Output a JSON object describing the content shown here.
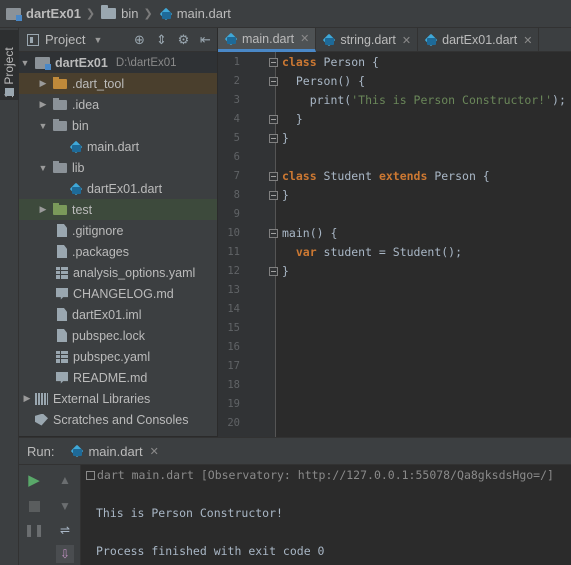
{
  "breadcrumb": {
    "items": [
      {
        "label": "dartEx01",
        "icon": "module-icon"
      },
      {
        "label": "bin",
        "icon": "folder-icon"
      },
      {
        "label": "main.dart",
        "icon": "dart-file-icon"
      }
    ]
  },
  "left_strip": {
    "project_tab": "1: Project"
  },
  "project_panel": {
    "title": "Project",
    "tools": [
      "target-icon",
      "collapse-icon",
      "gear-icon",
      "hide-icon"
    ]
  },
  "tree": {
    "root": {
      "label": "dartEx01",
      "path": "D:\\dartEx01"
    },
    "items": [
      {
        "label": ".dart_tool"
      },
      {
        "label": ".idea"
      },
      {
        "label": "bin"
      },
      {
        "label": "main.dart"
      },
      {
        "label": "lib"
      },
      {
        "label": "dartEx01.dart"
      },
      {
        "label": "test"
      },
      {
        "label": ".gitignore"
      },
      {
        "label": ".packages"
      },
      {
        "label": "analysis_options.yaml"
      },
      {
        "label": "CHANGELOG.md"
      },
      {
        "label": "dartEx01.iml"
      },
      {
        "label": "pubspec.lock"
      },
      {
        "label": "pubspec.yaml"
      },
      {
        "label": "README.md"
      },
      {
        "label": "External Libraries"
      },
      {
        "label": "Scratches and Consoles"
      }
    ]
  },
  "editor": {
    "tabs": [
      {
        "label": "main.dart",
        "active": true
      },
      {
        "label": "string.dart",
        "active": false
      },
      {
        "label": "dartEx01.dart",
        "active": false
      }
    ],
    "line_numbers": [
      "1",
      "2",
      "3",
      "4",
      "5",
      "6",
      "7",
      "8",
      "9",
      "10",
      "11",
      "12",
      "13",
      "14",
      "15",
      "16",
      "17",
      "18",
      "19",
      "20"
    ],
    "code": {
      "l1_kw": "class",
      "l1_rest": " Person {",
      "l2": "  Person() {",
      "l3_a": "    print(",
      "l3_str": "'This is Person Constructor!'",
      "l3_b": ");",
      "l4": "  }",
      "l5": "}",
      "l7_kw1": "class",
      "l7_mid": " Student ",
      "l7_kw2": "extends",
      "l7_rest": " Person {",
      "l8": "}",
      "l10": "main() {",
      "l11_kw": "  var",
      "l11_rest": " student = Student();",
      "l12": "}"
    }
  },
  "run": {
    "label": "Run:",
    "tab": "main.dart",
    "console": {
      "command": "dart main.dart [Observatory: http://127.0.0.1:55078/Qa8gksdsHgo=/]",
      "output": "This is Person Constructor!",
      "exit": "Process finished with exit code 0"
    }
  },
  "colors": {
    "accent": "#4a88c7",
    "keyword": "#cc7832",
    "string": "#6a8759",
    "run_green": "#59a869"
  }
}
